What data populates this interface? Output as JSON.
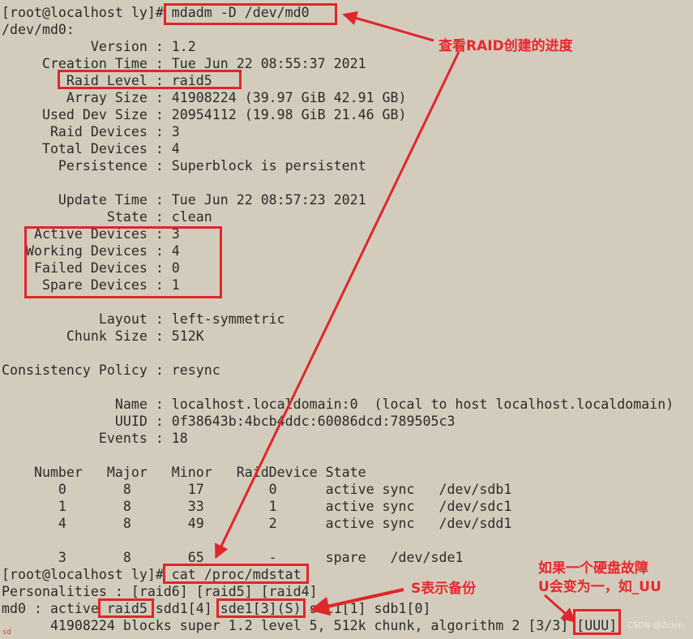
{
  "terminal": {
    "lines": [
      "[root@localhost ly]# mdadm -D /dev/md0",
      "/dev/md0:",
      "           Version : 1.2",
      "     Creation Time : Tue Jun 22 08:55:37 2021",
      "        Raid Level : raid5",
      "        Array Size : 41908224 (39.97 GiB 42.91 GB)",
      "     Used Dev Size : 20954112 (19.98 GiB 21.46 GB)",
      "      Raid Devices : 3",
      "     Total Devices : 4",
      "       Persistence : Superblock is persistent",
      "",
      "       Update Time : Tue Jun 22 08:57:23 2021",
      "             State : clean",
      "    Active Devices : 3",
      "   Working Devices : 4",
      "    Failed Devices : 0",
      "     Spare Devices : 1",
      "",
      "            Layout : left-symmetric",
      "        Chunk Size : 512K",
      "",
      "Consistency Policy : resync",
      "",
      "              Name : localhost.localdomain:0  (local to host localhost.localdomain)",
      "              UUID : 0f38643b:4bcb4ddc:60086dcd:789505c3",
      "            Events : 18",
      "",
      "    Number   Major   Minor   RaidDevice State",
      "       0       8       17        0      active sync   /dev/sdb1",
      "       1       8       33        1      active sync   /dev/sdc1",
      "       4       8       49        2      active sync   /dev/sdd1",
      "",
      "       3       8       65        -      spare   /dev/sde1",
      "[root@localhost ly]# cat /proc/mdstat",
      "Personalities : [raid6] [raid5] [raid4]",
      "md0 : active raid5 sdd1[4] sde1[3](S) sdc1[1] sdb1[0]",
      "      41908224 blocks super 1.2 level 5, 512k chunk, algorithm 2 [3/3] [UUU]"
    ]
  },
  "annotations": {
    "check_progress": "查看RAID创建的进度",
    "spare_note": "S表示备份",
    "failure_note_1": "如果一个硬盘故障",
    "failure_note_2": "U会变为一，如_UU"
  },
  "watermark": "CSDN @Zclen",
  "corner_mark": "sd",
  "colors": {
    "background": "#d3ccbc",
    "text": "#2b2b2b",
    "annotation": "#e0262c"
  }
}
